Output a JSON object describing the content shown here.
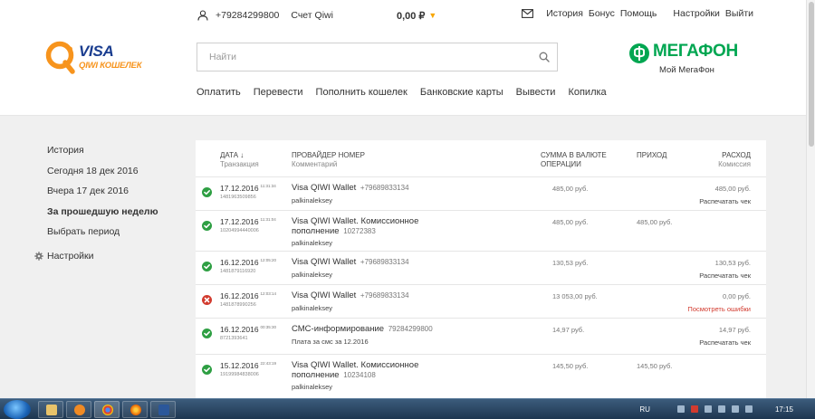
{
  "topbar": {
    "phone": "+79284299800",
    "account": "Счет Qiwi",
    "balance": "0,00 ₽",
    "balance_dropdown": "▼",
    "links": [
      "История",
      "Бонус",
      "Помощь",
      "Настройки",
      "Выйти"
    ]
  },
  "logo": {
    "visa": "VISA",
    "wallet": "QIWI КОШЕЛЕК"
  },
  "search": {
    "placeholder": "Найти"
  },
  "megafon": {
    "name": "МЕГАФОН",
    "sub": "Мой МегаФон"
  },
  "mainnav": [
    "Оплатить",
    "Перевести",
    "Пополнить кошелек",
    "Банковские карты",
    "Вывести",
    "Копилка"
  ],
  "sidebar": {
    "items": [
      "История",
      "Сегодня 18 дек 2016",
      "Вчера 17 дек 2016",
      "За прошедшую неделю",
      "Выбрать период"
    ],
    "settings": "Настройки"
  },
  "table": {
    "headers": {
      "date": "ДАТА ↓",
      "date_sub": "Транзакция",
      "provider": "ПРОВАЙДЕР НОМЕР",
      "provider_sub": "Комментарий",
      "amount": "СУММА В ВАЛЮТЕ ОПЕРАЦИИ",
      "income": "ПРИХОД",
      "expense": "РАСХОД",
      "expense_sub": "Комиссия"
    },
    "rows": [
      {
        "status": "ok",
        "date": "17.12.2016",
        "time": "11:31:34",
        "txid": "1481963509856",
        "provider": "Visa QIWI Wallet",
        "number": "+79689833134",
        "comment": "palkinaleksey",
        "amount": "485,00 руб.",
        "income": "",
        "expense": "485,00 руб.",
        "action": "Распечатать чек"
      },
      {
        "status": "ok",
        "date": "17.12.2016",
        "time": "11:31:04",
        "txid": "10204994440006",
        "provider": "Visa QIWI Wallet. Комиссионное пополнение",
        "number": "10272383",
        "comment": "palkinaleksey",
        "amount": "485,00 руб.",
        "income": "485,00 руб.",
        "expense": "",
        "action": ""
      },
      {
        "status": "ok",
        "date": "16.12.2016",
        "time": "12:05:20",
        "txid": "1481879116920",
        "provider": "Visa QIWI Wallet",
        "number": "+79689833134",
        "comment": "palkinaleksey",
        "amount": "130,53 руб.",
        "income": "",
        "expense": "130,53 руб.",
        "action": "Распечатать чек"
      },
      {
        "status": "err",
        "date": "16.12.2016",
        "time": "12:03:14",
        "txid": "1481878990256",
        "provider": "Visa QIWI Wallet",
        "number": "+79689833134",
        "comment": "palkinaleksey",
        "amount": "13 053,00 руб.",
        "income": "",
        "expense": "0,00 руб.",
        "action": "Посмотреть ошибки"
      },
      {
        "status": "ok",
        "date": "16.12.2016",
        "time": "00:35:30",
        "txid": "8721393641",
        "provider": "СМС-информирование",
        "number": "79284299800",
        "comment": "Плата за смс за 12.2016",
        "amount": "14,97 руб.",
        "income": "",
        "expense": "14,97 руб.",
        "action": "Распечатать чек"
      },
      {
        "status": "ok",
        "date": "15.12.2016",
        "time": "22:43:19",
        "txid": "19199984838006",
        "provider": "Visa QIWI Wallet. Комиссионное пополнение",
        "number": "10234108",
        "comment": "palkinaleksey",
        "amount": "145,50 руб.",
        "income": "145,50 руб.",
        "expense": "",
        "action": ""
      }
    ]
  },
  "taskbar": {
    "lang": "RU",
    "clock": "17:15"
  },
  "colors": {
    "qiwi_orange": "#f7941d",
    "visa_blue": "#1a3d8f",
    "megafon_green": "#00a651",
    "ok_green": "#2e9f43",
    "error_red": "#d23b2f"
  }
}
